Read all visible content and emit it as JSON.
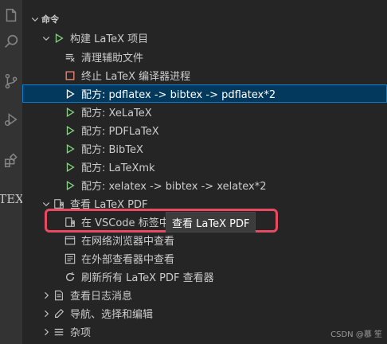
{
  "activity_bar": {
    "icons": [
      "explorer-icon",
      "search-icon",
      "source-control-icon",
      "run-debug-icon",
      "extensions-icon"
    ],
    "tex_label": "TEX"
  },
  "commands": {
    "section_title": "命令",
    "build_project": "构建 LaTeX 项目",
    "clean_aux": "清理辅助文件",
    "terminate_compiler": "终止 LaTeX 编译器进程",
    "recipes": [
      {
        "label": "配方: pdflatex -> bibtex -> pdflatex*2",
        "selected": true
      },
      {
        "label": "配方: XeLaTeX"
      },
      {
        "label": "配方: PDFLaTeX"
      },
      {
        "label": "配方: BibTeX"
      },
      {
        "label": "配方: LaTeXmk"
      },
      {
        "label": "配方: xelatex -> bibtex -> xelatex*2"
      }
    ],
    "view_pdf": {
      "label": "查看 LaTeX PDF",
      "items": [
        {
          "label": "在 VSCode 标签中查看"
        },
        {
          "label": "在网络浏览器中查看"
        },
        {
          "label": "在外部查看器中查看"
        },
        {
          "label": "刷新所有 LaTeX PDF 查看器"
        }
      ]
    },
    "view_log": "查看日志消息",
    "navigate": "导航、选择和编辑",
    "misc": "杂项"
  },
  "tooltip": "查看 LaTeX PDF",
  "watermark": "CSDN @慕 笙",
  "colors": {
    "accent": "#007fd4",
    "selection": "#04395e",
    "run_green": "#89d185",
    "stop_red": "#f48771",
    "highlight": "#e84a62"
  }
}
